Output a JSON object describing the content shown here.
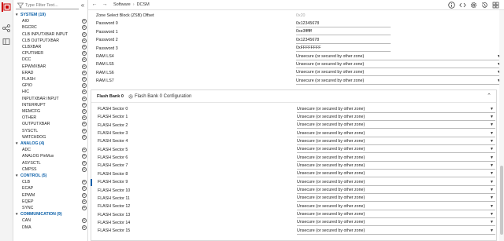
{
  "rail": {
    "icons": [
      "software-icon",
      "network-icon",
      "board-icon"
    ]
  },
  "sidebar": {
    "filter_placeholder": "Type Filter Text...",
    "categories": [
      {
        "label": "SYSTEM (19)",
        "items": [
          "AIO",
          "BGCRC",
          "CLB INPUTXBAR INPUT",
          "CLB OUTPUTXBAR",
          "CLBXBAR",
          "CPUTIMER",
          "DCC",
          "EPWMXBAR",
          "ERAD",
          "FLASH",
          "GPIO",
          "HIC",
          "INPUTXBAR INPUT",
          "INTERRUPT",
          "MEMCFG",
          "OTHER",
          "OUTPUTXBAR",
          "SYSCTL",
          "WATCHDOG"
        ]
      },
      {
        "label": "ANALOG (4)",
        "items": [
          "ADC",
          "ANALOG PinMux",
          "ASYSCTL",
          "CMPSS"
        ]
      },
      {
        "label": "CONTROL (5)",
        "items": [
          "CLB",
          "ECAP",
          "EPWM",
          "EQEP",
          "SYNC"
        ]
      },
      {
        "label": "COMMUNICATION (9)",
        "items": [
          "CAN",
          "DMA"
        ]
      }
    ]
  },
  "topbar": {
    "breadcrumb": [
      "Software",
      "DCSM"
    ]
  },
  "main": {
    "top_rows": [
      {
        "label": "Zone Select Block (ZSB) Offset",
        "value": "0x20",
        "kind": "placeholder"
      },
      {
        "label": "Password 0",
        "value": "0x12345678",
        "kind": "text"
      },
      {
        "label": "Password 1",
        "value": "0xe3ffffff",
        "kind": "text"
      },
      {
        "label": "Password 2",
        "value": "0x12345678",
        "kind": "text"
      },
      {
        "label": "Password 3",
        "value": "0xFFFFFFFF",
        "kind": "text"
      },
      {
        "label": "RAM LS4",
        "value": "Unsecure (or secured by other zone)",
        "kind": "select"
      },
      {
        "label": "RAM LS5",
        "value": "Unsecure (or secured by other zone)",
        "kind": "select"
      },
      {
        "label": "RAM LS6",
        "value": "Unsecure (or secured by other zone)",
        "kind": "select"
      },
      {
        "label": "RAM LS7",
        "value": "Unsecure (or secured by other zone)",
        "kind": "select"
      }
    ],
    "panel": {
      "title": "Flash Bank 0",
      "config_label": "Flash Bank 0 Configuration",
      "sectors": [
        {
          "label": "FLASH Sector 0",
          "value": "Unsecure (or secured by other zone)"
        },
        {
          "label": "FLASH Sector 1",
          "value": "Unsecure (or secured by other zone)"
        },
        {
          "label": "FLASH Sector 2",
          "value": "Unsecure (or secured by other zone)"
        },
        {
          "label": "FLASH Sector 3",
          "value": "Unsecure (or secured by other zone)"
        },
        {
          "label": "FLASH Sector 4",
          "value": "Unsecure (or secured by other zone)"
        },
        {
          "label": "FLASH Sector 5",
          "value": "Unsecure (or secured by other zone)"
        },
        {
          "label": "FLASH Sector 6",
          "value": "Unsecure (or secured by other zone)"
        },
        {
          "label": "FLASH Sector 7",
          "value": "Unsecure (or secured by other zone)"
        },
        {
          "label": "FLASH Sector 8",
          "value": "Unsecure (or secured by other zone)"
        },
        {
          "label": "FLASH Sector 9",
          "value": "Unsecure (or secured by other zone)"
        },
        {
          "label": "FLASH Sector 10",
          "value": "Unsecure (or secured by other zone)"
        },
        {
          "label": "FLASH Sector 11",
          "value": "Unsecure (or secured by other zone)"
        },
        {
          "label": "FLASH Sector 12",
          "value": "Unsecure (or secured by other zone)"
        },
        {
          "label": "FLASH Sector 13",
          "value": "Unsecure (or secured by other zone)"
        },
        {
          "label": "FLASH Sector 14",
          "value": "Unsecure (or secured by other zone)"
        },
        {
          "label": "FLASH Sector 15",
          "value": "Unsecure (or secured by other zone)"
        }
      ],
      "selected_sector": "FLASH Sector 9"
    }
  },
  "colors": {
    "accent": "#0a5fa8",
    "brand": "#cc0000",
    "border": "#d9d9d9"
  }
}
